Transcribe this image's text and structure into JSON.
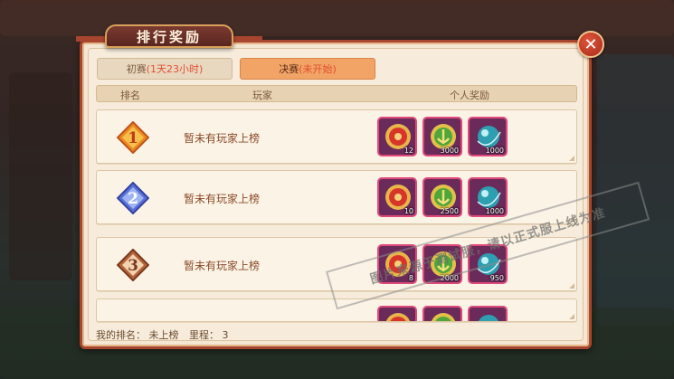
{
  "title": "排行奖励",
  "close_glyph": "✕",
  "tabs": [
    {
      "label": "初赛",
      "status": "(1天23小时)"
    },
    {
      "label": "决赛",
      "status": "(未开始)"
    }
  ],
  "columns": {
    "rank": "排名",
    "player": "玩家",
    "reward": "个人奖励"
  },
  "rows": [
    {
      "rank": "1",
      "player": "暂未有玩家上榜",
      "rewards": [
        {
          "icon": "red-medal-icon",
          "qty": "12"
        },
        {
          "icon": "green-anchor-coin-icon",
          "qty": "3000"
        },
        {
          "icon": "blue-orb-icon",
          "qty": "1000"
        }
      ]
    },
    {
      "rank": "2",
      "player": "暂未有玩家上榜",
      "rewards": [
        {
          "icon": "red-medal-icon",
          "qty": "10"
        },
        {
          "icon": "green-anchor-coin-icon",
          "qty": "2500"
        },
        {
          "icon": "blue-orb-icon",
          "qty": "1000"
        }
      ]
    },
    {
      "rank": "3",
      "player": "暂未有玩家上榜",
      "rewards": [
        {
          "icon": "red-medal-icon",
          "qty": "8"
        },
        {
          "icon": "green-anchor-coin-icon",
          "qty": "2000"
        },
        {
          "icon": "blue-orb-icon",
          "qty": "950"
        }
      ]
    }
  ],
  "footer": {
    "label": "我的排名：",
    "rank_value": "未上榜",
    "mileage_label": "里程：",
    "mileage_value": "3"
  },
  "watermark": "图片来源于测试服，请以正式服上线为准",
  "colors": {
    "accent": "#a8452f",
    "active_tab": "#f1a466",
    "status_red": "#e24e33"
  }
}
